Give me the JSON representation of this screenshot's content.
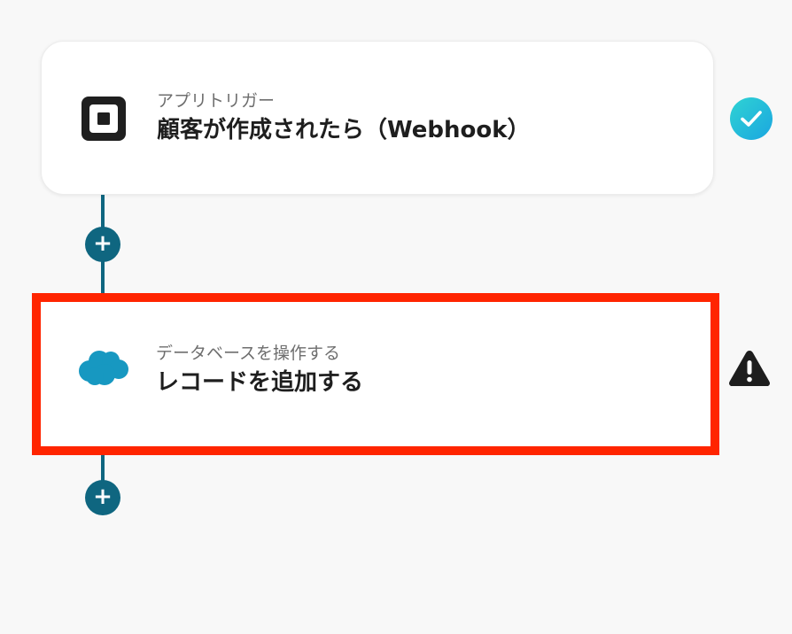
{
  "steps": [
    {
      "subtitle": "アプリトリガー",
      "title": "顧客が作成されたら（Webhook）",
      "app_icon": "square-logo-icon",
      "status_icon": "check-icon",
      "status": "complete"
    },
    {
      "subtitle": "データベースを操作する",
      "title": "レコードを追加する",
      "app_icon": "salesforce-cloud-icon",
      "status_icon": "warning-icon",
      "status": "warning",
      "highlighted": true
    }
  ],
  "add_step_label": "+",
  "colors": {
    "connector": "#0f6680",
    "check_gradient_start": "#2fd3d3",
    "check_gradient_end": "#1ba6e0",
    "highlight_border": "#ff2500",
    "salesforce_blue": "#1798c1",
    "warning": "#1e1e1e"
  }
}
